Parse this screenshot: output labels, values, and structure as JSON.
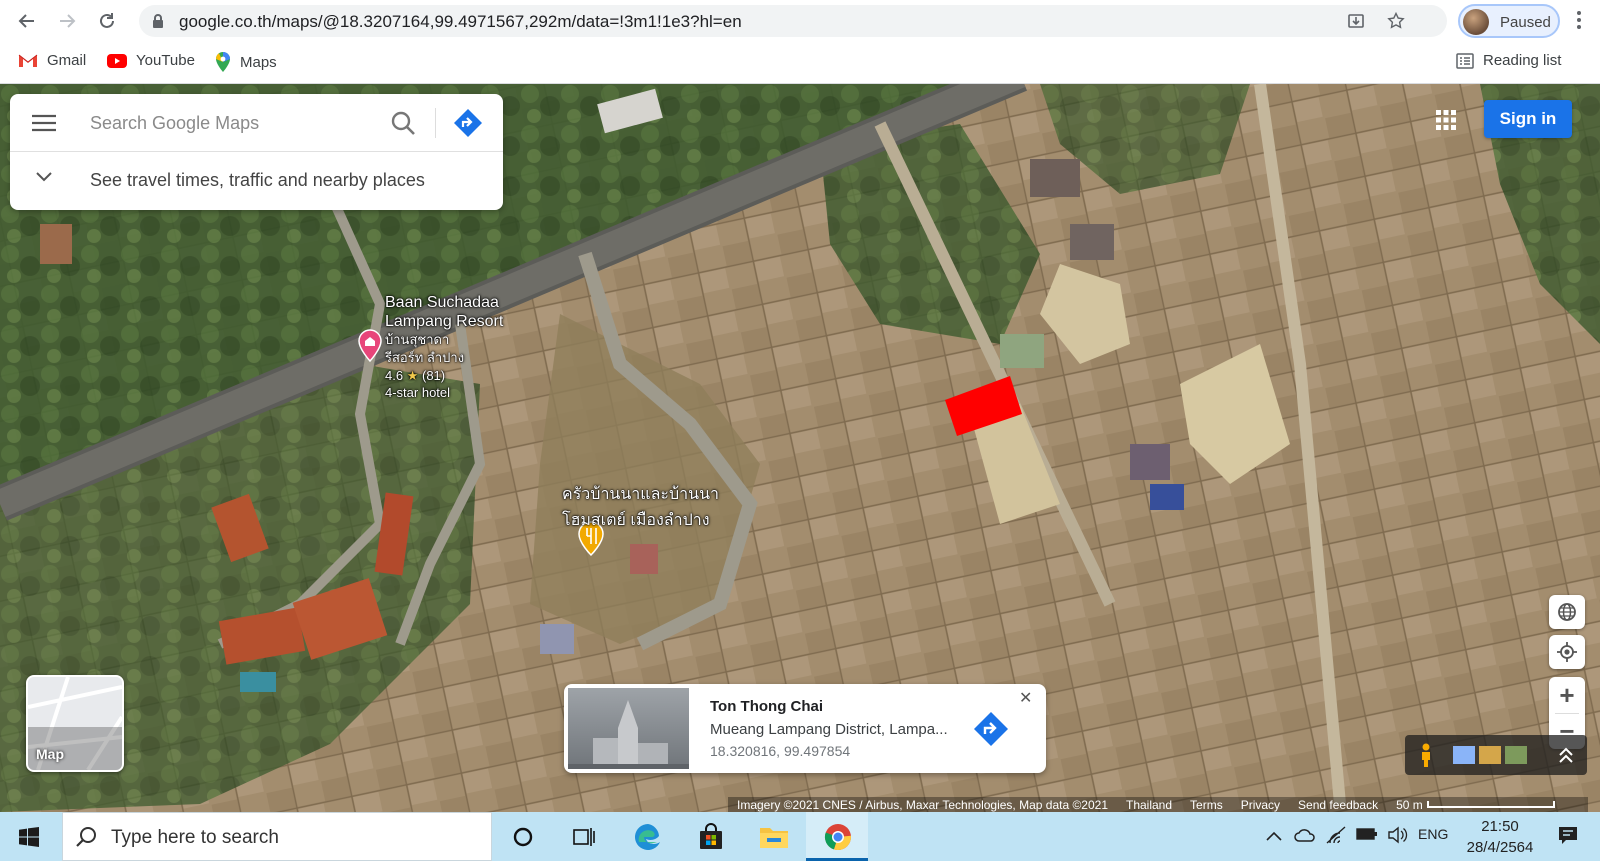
{
  "browser": {
    "url": "google.co.th/maps/@18.3207164,99.4971567,292m/data=!3m1!1e3?hl=en",
    "profile_status": "Paused",
    "bookmarks": [
      {
        "label": "Gmail",
        "icon": "gmail-icon"
      },
      {
        "label": "YouTube",
        "icon": "youtube-icon"
      },
      {
        "label": "Maps",
        "icon": "maps-pin-icon"
      }
    ],
    "reading_list": "Reading list"
  },
  "maps": {
    "search_placeholder": "Search Google Maps",
    "travel_hint": "See travel times, traffic and nearby places",
    "sign_in": "Sign in",
    "layer_label": "Map",
    "pois": [
      {
        "name_line1": "Baan Suchadaa",
        "name_line2": "Lampang Resort",
        "thai_line1": "บ้านสุชาดา",
        "thai_line2": "รีสอร์ท ลำปาง",
        "rating": "4.6",
        "reviews": "(81)",
        "category": "4-star hotel",
        "icon": "hotel-pin-icon"
      },
      {
        "thai_line1": "ครัวบ้านนาและบ้านนา",
        "thai_line2": "โฮมสเตย์ เมืองลำปาง",
        "icon": "restaurant-pin-icon"
      }
    ],
    "info_card": {
      "title": "Ton Thong Chai",
      "subtitle": "Mueang Lampang District, Lampa...",
      "coords": "18.320816, 99.497854"
    },
    "attribution": {
      "imagery": "Imagery ©2021 CNES / Airbus, Maxar Technologies, Map data ©2021",
      "country": "Thailand",
      "terms": "Terms",
      "privacy": "Privacy",
      "feedback": "Send feedback",
      "scale": "50 m"
    },
    "colors": {
      "accent": "#1a73e8",
      "marker": "#ff0000",
      "hotel_pin": "#e8457a",
      "food_pin": "#f2a900"
    }
  },
  "taskbar": {
    "search_placeholder": "Type here to search",
    "language": "ENG",
    "time": "21:50",
    "date": "28/4/2564"
  }
}
